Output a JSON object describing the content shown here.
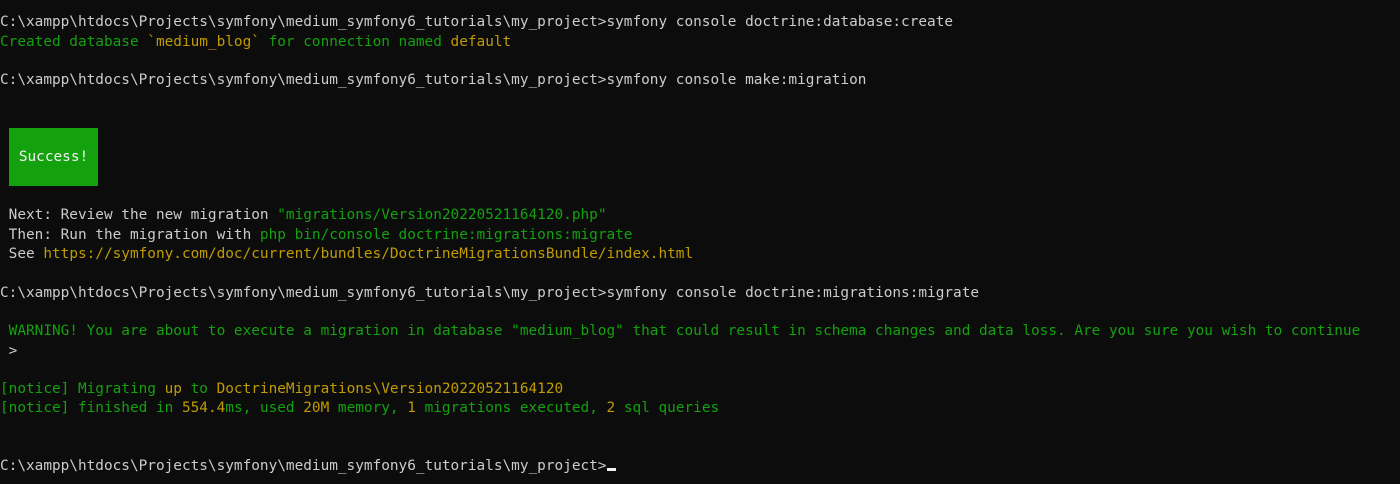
{
  "terminal": {
    "prompt": "C:\\xampp\\htdocs\\Projects\\symfony\\medium_symfony6_tutorials\\my_project>",
    "commands": {
      "create_db": "symfony console doctrine:database:create",
      "make_migration": "symfony console make:migration",
      "migrate": "symfony console doctrine:migrations:migrate"
    },
    "created": {
      "p1": "Created database ",
      "dbname": "`medium_blog`",
      "p2": " for connection named ",
      "conn": "default"
    },
    "success_label": "Success!",
    "next": {
      "label": " Next: Review the new migration ",
      "file": "\"migrations/Version20220521164120.php\""
    },
    "then": {
      "label": " Then: Run the migration with ",
      "cmd": "php bin/console doctrine:migrations:migrate"
    },
    "see": {
      "label": " See ",
      "url": "https://symfony.com/doc/current/bundles/DoctrineMigrationsBundle/index.html"
    },
    "warning": " WARNING! You are about to execute a migration in database \"medium_blog\" that could result in schema changes and data loss. Are you sure you wish to continue",
    "answer_prompt": " >",
    "notice1": {
      "tag": "[notice] ",
      "p1": "Migrating ",
      "up": "up",
      "p2": " to ",
      "version": "DoctrineMigrations\\Version20220521164120"
    },
    "notice2": {
      "tag": "[notice] ",
      "p1": "finished in ",
      "ms_val": "554.4",
      "p2": "ms, used ",
      "mem_val": "20M",
      "p3": " memory, ",
      "mig_count": "1",
      "p4": " migrations executed, ",
      "sql_count": "2",
      "p5": " sql queries"
    },
    "colors": {
      "background": "#0c0c0c",
      "foreground": "#cccccc",
      "green": "#13a10e",
      "yellow": "#c19c00"
    }
  }
}
